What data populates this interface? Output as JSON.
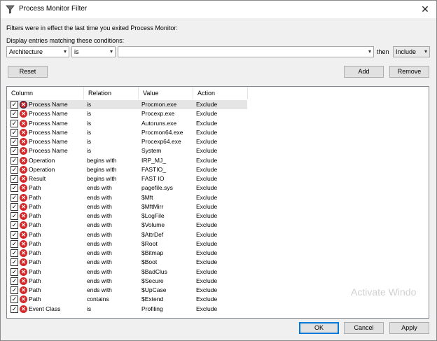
{
  "window": {
    "title": "Process Monitor Filter"
  },
  "intro_text": "Filters were in effect the last time you exited Process Monitor:",
  "display_text": "Display entries matching these conditions:",
  "filter_builder": {
    "column_value": "Architecture",
    "relation_value": "is",
    "value_text": "",
    "then_label": "then",
    "action_value": "Include"
  },
  "buttons": {
    "reset": "Reset",
    "add": "Add",
    "remove": "Remove",
    "ok": "OK",
    "cancel": "Cancel",
    "apply": "Apply"
  },
  "table": {
    "headers": [
      "Column",
      "Relation",
      "Value",
      "Action"
    ],
    "rows": [
      [
        "Process Name",
        "is",
        "Procmon.exe",
        "Exclude"
      ],
      [
        "Process Name",
        "is",
        "Procexp.exe",
        "Exclude"
      ],
      [
        "Process Name",
        "is",
        "Autoruns.exe",
        "Exclude"
      ],
      [
        "Process Name",
        "is",
        "Procmon64.exe",
        "Exclude"
      ],
      [
        "Process Name",
        "is",
        "Procexp64.exe",
        "Exclude"
      ],
      [
        "Process Name",
        "is",
        "System",
        "Exclude"
      ],
      [
        "Operation",
        "begins with",
        "IRP_MJ_",
        "Exclude"
      ],
      [
        "Operation",
        "begins with",
        "FASTIO_",
        "Exclude"
      ],
      [
        "Result",
        "begins with",
        "FAST IO",
        "Exclude"
      ],
      [
        "Path",
        "ends with",
        "pagefile.sys",
        "Exclude"
      ],
      [
        "Path",
        "ends with",
        "$Mft",
        "Exclude"
      ],
      [
        "Path",
        "ends with",
        "$MftMirr",
        "Exclude"
      ],
      [
        "Path",
        "ends with",
        "$LogFile",
        "Exclude"
      ],
      [
        "Path",
        "ends with",
        "$Volume",
        "Exclude"
      ],
      [
        "Path",
        "ends with",
        "$AttrDef",
        "Exclude"
      ],
      [
        "Path",
        "ends with",
        "$Root",
        "Exclude"
      ],
      [
        "Path",
        "ends with",
        "$Bitmap",
        "Exclude"
      ],
      [
        "Path",
        "ends with",
        "$Boot",
        "Exclude"
      ],
      [
        "Path",
        "ends with",
        "$BadClus",
        "Exclude"
      ],
      [
        "Path",
        "ends with",
        "$Secure",
        "Exclude"
      ],
      [
        "Path",
        "ends with",
        "$UpCase",
        "Exclude"
      ],
      [
        "Path",
        "contains",
        "$Extend",
        "Exclude"
      ],
      [
        "Event Class",
        "is",
        "Profiling",
        "Exclude"
      ]
    ]
  },
  "watermark": "Activate Windo",
  "icons": {
    "checkbox": "checked-checkbox-icon",
    "exclude": "exclude-x-icon",
    "app": "filter-funnel-icon",
    "close": "close-icon"
  },
  "colors": {
    "exclude_red": "#d42a2a",
    "accent": "#0078d7",
    "selected_row": "#e5e5e5"
  }
}
